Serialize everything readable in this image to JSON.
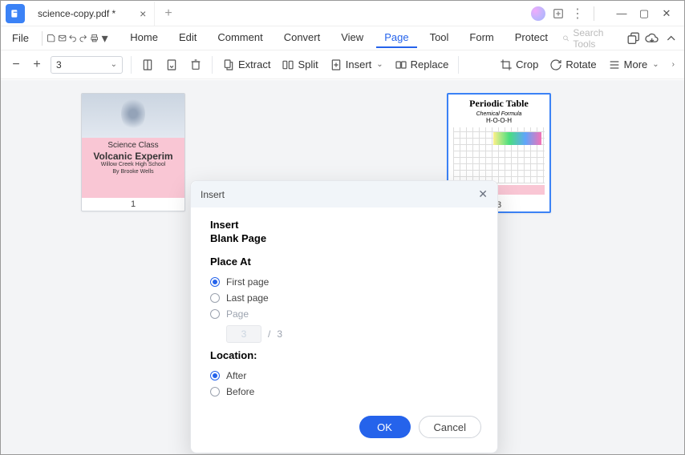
{
  "titlebar": {
    "tab_title": "science-copy.pdf *"
  },
  "menubar": {
    "file": "File",
    "items": [
      "Home",
      "Edit",
      "Comment",
      "Convert",
      "View",
      "Page",
      "Tool",
      "Form",
      "Protect"
    ],
    "active_index": 5,
    "search_placeholder": "Search Tools"
  },
  "toolbar": {
    "zoom_value": "3",
    "extract": "Extract",
    "split": "Split",
    "insert": "Insert",
    "replace": "Replace",
    "crop": "Crop",
    "rotate": "Rotate",
    "more": "More"
  },
  "thumbs": {
    "p1": {
      "num": "1",
      "line1": "Science Class",
      "line2": "Volcanic Experim",
      "line3": "Willow Creek High School",
      "line4": "By Brooke Wells"
    },
    "p3": {
      "num": "3",
      "title": "Periodic Table",
      "sub": "Chemical Formula",
      "formula": "H-O-O-H"
    }
  },
  "dialog": {
    "title": "Insert",
    "h1": "Insert",
    "h2": "Blank Page",
    "place_at": "Place At",
    "first_page": "First page",
    "last_page": "Last page",
    "page": "Page",
    "page_value": "3",
    "page_sep": "/",
    "page_total": "3",
    "location": "Location:",
    "after": "After",
    "before": "Before",
    "ok": "OK",
    "cancel": "Cancel"
  }
}
